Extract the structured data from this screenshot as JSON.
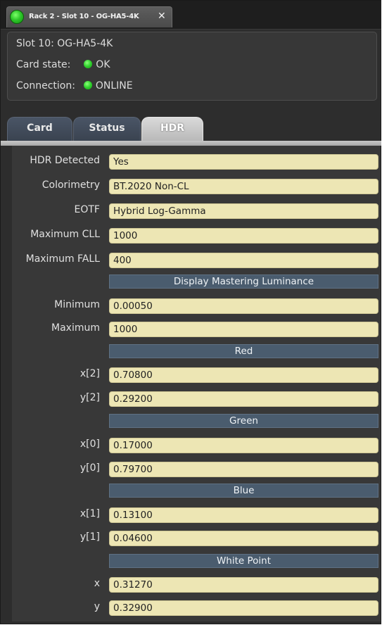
{
  "window": {
    "tab_title": "Rack 2 - Slot 10 - OG-HA5-4K",
    "close_glyph": "✕"
  },
  "info": {
    "slot": "Slot 10: OG-HA5-4K",
    "card_state_label": "Card state:",
    "card_state_value": "OK",
    "connection_label": "Connection:",
    "connection_value": "ONLINE",
    "status_color": "#2fd02c"
  },
  "tabs": [
    {
      "label": "Card",
      "active": false
    },
    {
      "label": "Status",
      "active": false
    },
    {
      "label": "HDR",
      "active": true
    }
  ],
  "hdr": {
    "detected_label": "HDR Detected",
    "detected_value": "Yes",
    "colorimetry_label": "Colorimetry",
    "colorimetry_value": "BT.2020 Non-CL",
    "eotf_label": "EOTF",
    "eotf_value": "Hybrid Log-Gamma",
    "max_cll_label": "Maximum CLL",
    "max_cll_value": "1000",
    "max_fall_label": "Maximum FALL",
    "max_fall_value": "400",
    "dml_header": "Display Mastering Luminance",
    "min_label": "Minimum",
    "min_value": "0.00050",
    "max_label": "Maximum",
    "max_value": "1000",
    "red_header": "Red",
    "red_x_label": "x[2]",
    "red_x_value": "0.70800",
    "red_y_label": "y[2]",
    "red_y_value": "0.29200",
    "green_header": "Green",
    "green_x_label": "x[0]",
    "green_x_value": "0.17000",
    "green_y_label": "y[0]",
    "green_y_value": "0.79700",
    "blue_header": "Blue",
    "blue_x_label": "x[1]",
    "blue_x_value": "0.13100",
    "blue_y_label": "y[1]",
    "blue_y_value": "0.04600",
    "white_header": "White Point",
    "white_x_label": "x",
    "white_x_value": "0.31270",
    "white_y_label": "y",
    "white_y_value": "0.32900"
  },
  "colors": {
    "field_bg": "#ede6b4",
    "section_bg": "#4a5c6e",
    "panel_bg": "#383838"
  }
}
